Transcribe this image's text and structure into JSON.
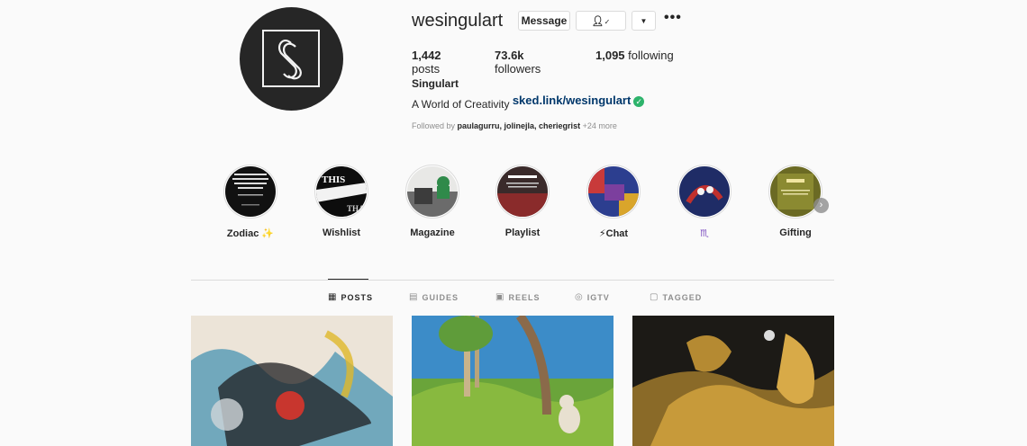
{
  "profile": {
    "username": "wesingulart",
    "message_label": "Message",
    "follow_icon": "person-check-icon",
    "dropdown_icon": "caret-down-icon",
    "more_icon": "more-options-icon",
    "posts_count": "1,442",
    "posts_label": " posts",
    "followers_count": "73.6k",
    "followers_label": " followers",
    "following_count": "1,095",
    "following_label": " following",
    "full_name": "Singulart",
    "bio_text": "A World of Creativity ",
    "bio_link": "sked.link/wesingulart",
    "followed_prefix": "Followed by ",
    "followed_names": "paulagurru, jolinejla, cheriegrist",
    "followed_more": " +24 more"
  },
  "highlights": [
    {
      "label": "Zodiac ✨"
    },
    {
      "label": "Wishlist"
    },
    {
      "label": "Magazine"
    },
    {
      "label": "Playlist"
    },
    {
      "label": "⚡Chat"
    },
    {
      "label": "♏"
    },
    {
      "label": "Gifting"
    }
  ],
  "tabs": [
    {
      "label": "POSTS",
      "icon": "grid-icon",
      "active": true
    },
    {
      "label": "GUIDES",
      "icon": "guides-icon",
      "active": false
    },
    {
      "label": "REELS",
      "icon": "reels-icon",
      "active": false
    },
    {
      "label": "IGTV",
      "icon": "igtv-icon",
      "active": false
    },
    {
      "label": "TAGGED",
      "icon": "tagged-icon",
      "active": false
    }
  ],
  "colors": {
    "background": "#fafafa",
    "text": "#262626",
    "muted": "#8e8e8e",
    "link": "#00376b",
    "verified": "#2db36b"
  }
}
